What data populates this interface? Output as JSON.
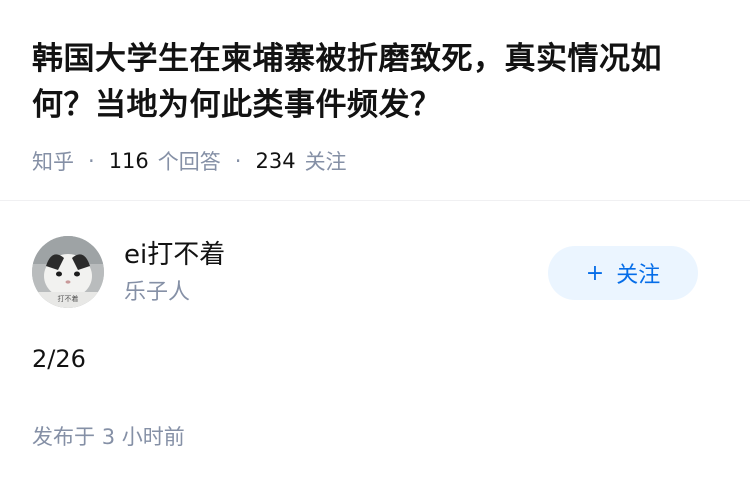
{
  "question": {
    "title": "韩国大学生在柬埔寨被折磨致死，真实情况如何？当地为何此类事件频发？",
    "source": "知乎",
    "answer_count": "116",
    "answer_label": "个回答",
    "follower_count": "234",
    "follower_label": "关注"
  },
  "author": {
    "name": "ei打不着",
    "bio": "乐子人",
    "avatar_caption": "打不着",
    "follow_plus": "+",
    "follow_label": "关注"
  },
  "answer": {
    "text": "2/26",
    "published_label": "发布于",
    "published_time": "3 小时前"
  },
  "colors": {
    "title": "#121212",
    "meta": "#8590a6",
    "follow_bg": "#ebf5ff",
    "follow_text": "#056de8"
  }
}
